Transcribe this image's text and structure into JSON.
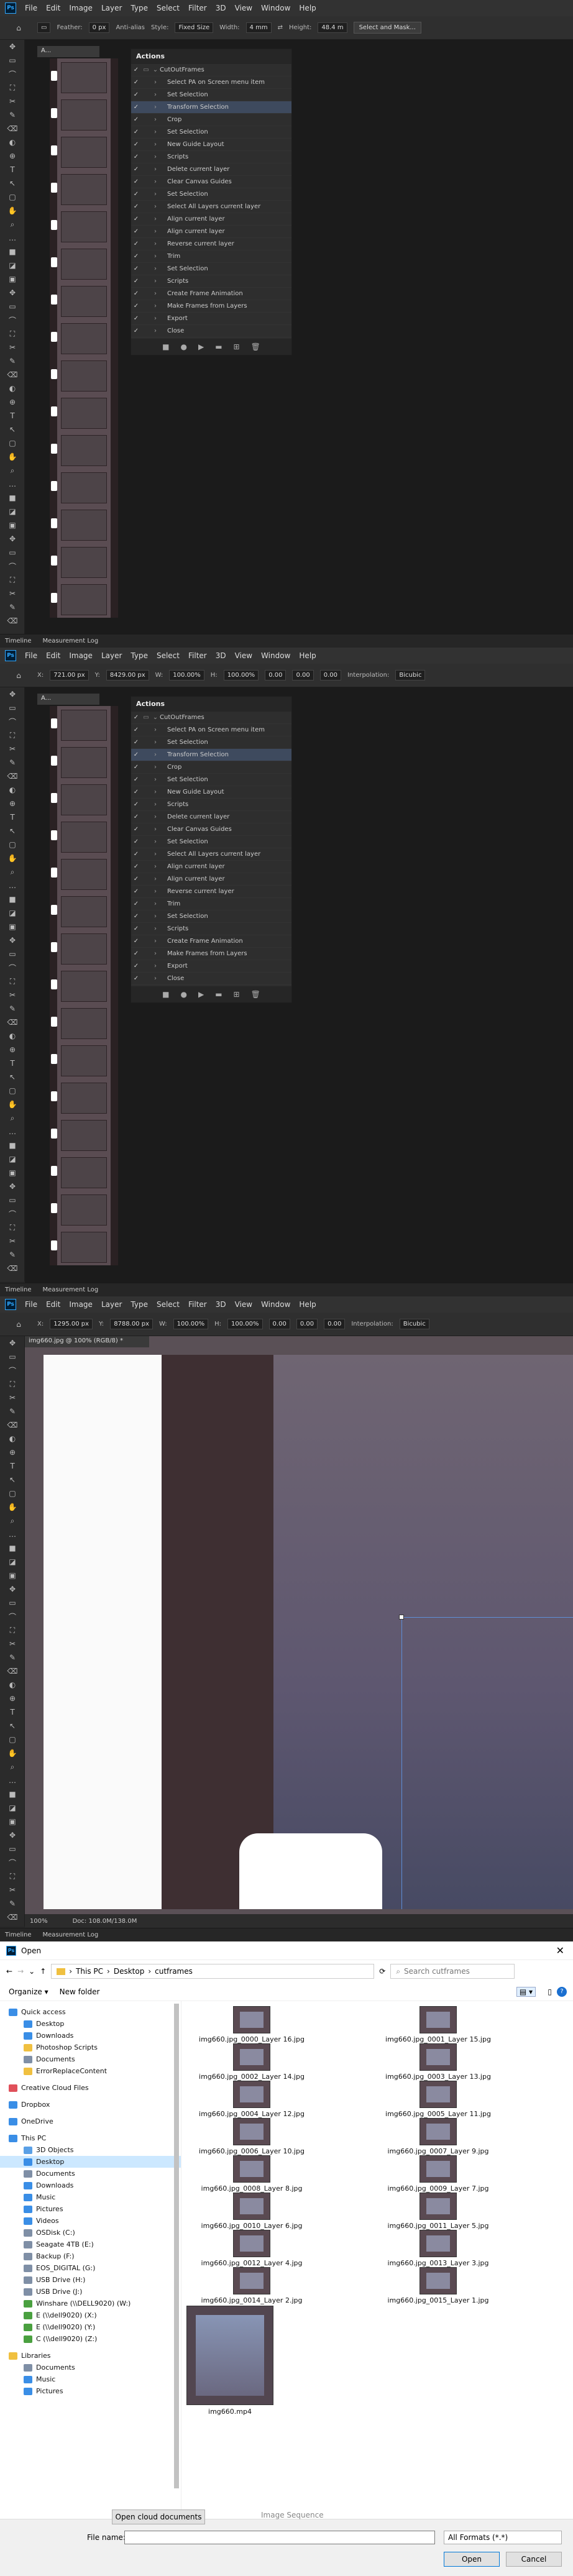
{
  "menu": [
    "Ps",
    "File",
    "Edit",
    "Image",
    "Layer",
    "Type",
    "Select",
    "Filter",
    "3D",
    "View",
    "Window",
    "Help"
  ],
  "options1": {
    "feather_label": "Feather:",
    "feather_value": "0 px",
    "antialias": "Anti-alias",
    "style_label": "Style:",
    "style_value": "Fixed Size",
    "width_label": "Width:",
    "width_value": "4 mm",
    "height_label": "Height:",
    "height_value": "48.4 m",
    "select_mask": "Select and Mask..."
  },
  "options2": {
    "x_label": "X:",
    "x_value": "721.00 px",
    "y_label": "Y:",
    "y_value": "8429.00 px",
    "w_label": "W:",
    "w_value": "100.00%",
    "h_label": "H:",
    "h_value": "100.00%",
    "angle": "0.00",
    "hskew": "0.00",
    "vskew": "0.00",
    "interp_label": "Interpolation:",
    "interp_value": "Bicubic"
  },
  "options3": {
    "x_label": "X:",
    "x_value": "1295.00 px",
    "y_label": "Y:",
    "y_value": "8788.00 px",
    "w_label": "W:",
    "w_value": "100.00%",
    "h_label": "H:",
    "h_value": "100.00%",
    "angle": "0.00",
    "hskew": "0.00",
    "vskew": "0.00",
    "interp_label": "Interpolation:",
    "interp_value": "Bicubic"
  },
  "doc_tab_small": "A...",
  "doc_tab_big": "img660.jpg @ 100% (RGB/8) *",
  "zoom": "100%",
  "doc_info": "Doc: 108.0M/138.0M",
  "bottom_tabs": [
    "Timeline",
    "Measurement Log"
  ],
  "actions": {
    "title": "Actions",
    "set_name": "CutOutFrames",
    "items": [
      "Select PA on Screen menu item",
      "Set Selection",
      "Transform Selection",
      "Crop",
      "Set Selection",
      "New Guide Layout",
      "Scripts",
      "Delete current layer",
      "Clear Canvas Guides",
      "Set Selection",
      "Select All Layers current layer",
      "Align current layer",
      "Align current layer",
      "Reverse current layer",
      "Trim",
      "Set Selection",
      "Scripts",
      "Create Frame Animation",
      "Make Frames from Layers",
      "Export",
      "Close"
    ],
    "selected_index": 2
  },
  "dialog": {
    "title": "Open",
    "path": [
      "This PC",
      "Desktop",
      "cutframes"
    ],
    "search_placeholder": "Search cutframes",
    "organize": "Organize",
    "new_folder": "New folder",
    "nav": [
      {
        "label": "Quick access",
        "color": "#3a8ee6",
        "indent": 0
      },
      {
        "label": "Desktop",
        "color": "#3a8ee6",
        "indent": 1
      },
      {
        "label": "Downloads",
        "color": "#3a8ee6",
        "indent": 1
      },
      {
        "label": "Photoshop Scripts",
        "color": "#f0c040",
        "indent": 1
      },
      {
        "label": "Documents",
        "color": "#7f8fa6",
        "indent": 1
      },
      {
        "label": "ErrorReplaceContent",
        "color": "#f0c040",
        "indent": 1
      },
      {
        "label": "Creative Cloud Files",
        "color": "#e0505a",
        "indent": 0
      },
      {
        "label": "Dropbox",
        "color": "#3a8ee6",
        "indent": 0
      },
      {
        "label": "OneDrive",
        "color": "#3a8ee6",
        "indent": 0
      },
      {
        "label": "This PC",
        "color": "#3a8ee6",
        "indent": 0
      },
      {
        "label": "3D Objects",
        "color": "#5aa0e6",
        "indent": 1
      },
      {
        "label": "Desktop",
        "color": "#3a8ee6",
        "indent": 1
      },
      {
        "label": "Documents",
        "color": "#7f8fa6",
        "indent": 1
      },
      {
        "label": "Downloads",
        "color": "#3a8ee6",
        "indent": 1
      },
      {
        "label": "Music",
        "color": "#3a8ee6",
        "indent": 1
      },
      {
        "label": "Pictures",
        "color": "#3a8ee6",
        "indent": 1
      },
      {
        "label": "Videos",
        "color": "#3a8ee6",
        "indent": 1
      },
      {
        "label": "OSDisk (C:)",
        "color": "#7f8fa6",
        "indent": 1
      },
      {
        "label": "Seagate 4TB (E:)",
        "color": "#7f8fa6",
        "indent": 1
      },
      {
        "label": "Backup (F:)",
        "color": "#7f8fa6",
        "indent": 1
      },
      {
        "label": "EOS_DIGITAL (G:)",
        "color": "#7f8fa6",
        "indent": 1
      },
      {
        "label": "USB Drive (H:)",
        "color": "#7f8fa6",
        "indent": 1
      },
      {
        "label": "USB Drive (J:)",
        "color": "#7f8fa6",
        "indent": 1
      },
      {
        "label": "Winshare (\\\\DELL9020) (W:)",
        "color": "#4aa040",
        "indent": 1
      },
      {
        "label": "E (\\\\dell9020) (X:)",
        "color": "#4aa040",
        "indent": 1
      },
      {
        "label": "E (\\\\dell9020) (Y:)",
        "color": "#4aa040",
        "indent": 1
      },
      {
        "label": "C (\\\\dell9020) (Z:)",
        "color": "#4aa040",
        "indent": 1
      },
      {
        "label": "Libraries",
        "color": "#f0c040",
        "indent": 0
      },
      {
        "label": "Documents",
        "color": "#7f8fa6",
        "indent": 1
      },
      {
        "label": "Music",
        "color": "#3a8ee6",
        "indent": 1
      },
      {
        "label": "Pictures",
        "color": "#3a8ee6",
        "indent": 1
      }
    ],
    "selected_nav": 11,
    "files": [
      "img660.jpg_0000_Layer 16.jpg",
      "img660.jpg_0001_Layer 15.jpg",
      "img660.jpg_0002_Layer 14.jpg",
      "img660.jpg_0003_Layer 13.jpg",
      "img660.jpg_0004_Layer 12.jpg",
      "img660.jpg_0005_Layer 11.jpg",
      "img660.jpg_0006_Layer 10.jpg",
      "img660.jpg_0007_Layer 9.jpg",
      "img660.jpg_0008_Layer 8.jpg",
      "img660.jpg_0009_Layer 7.jpg",
      "img660.jpg_0010_Layer 6.jpg",
      "img660.jpg_0011_Layer 5.jpg",
      "img660.jpg_0012_Layer 4.jpg",
      "img660.jpg_0013_Layer 3.jpg",
      "img660.jpg_0014_Layer 2.jpg",
      "img660.jpg_0015_Layer 1.jpg"
    ],
    "video_file": "img660.mp4",
    "cloud_button": "Open cloud documents",
    "image_sequence": "Image Sequence",
    "filename_label": "File name:",
    "filetype": "All Formats (*.*)",
    "open": "Open",
    "cancel": "Cancel"
  }
}
